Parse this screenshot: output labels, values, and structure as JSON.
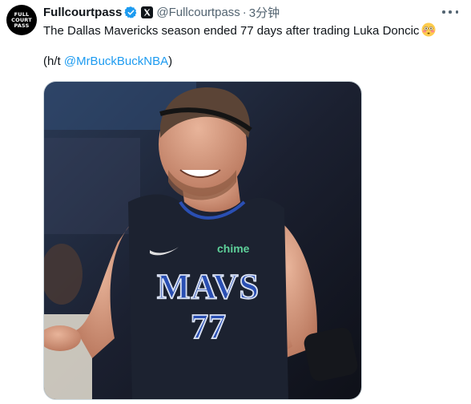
{
  "author": {
    "avatar_text": [
      "FULL",
      "COURT",
      "PASS"
    ],
    "display_name": "Fullcourtpass",
    "handle": "@Fullcourtpass",
    "separator": "·",
    "time": "3分钟"
  },
  "tweet": {
    "text": "The Dallas Mavericks season ended 77 days after trading Luka Doncic",
    "emoji": "flushed-face",
    "ht_prefix": "(h/t ",
    "mention": "@MrBuckBuckNBA",
    "ht_suffix": ")"
  },
  "media": {
    "jersey_wordmark": "MAVS",
    "jersey_number": "77",
    "sponsor": "chime"
  },
  "colors": {
    "link": "#1d9bf0",
    "text": "#0f1419",
    "secondary": "#536471",
    "verified": "#1d9bf0",
    "jersey": "#1c2230",
    "jersey_letters": "#2a4fb3"
  },
  "icons": [
    "verified-badge-icon",
    "affiliate-badge-icon",
    "more-options-icon"
  ]
}
